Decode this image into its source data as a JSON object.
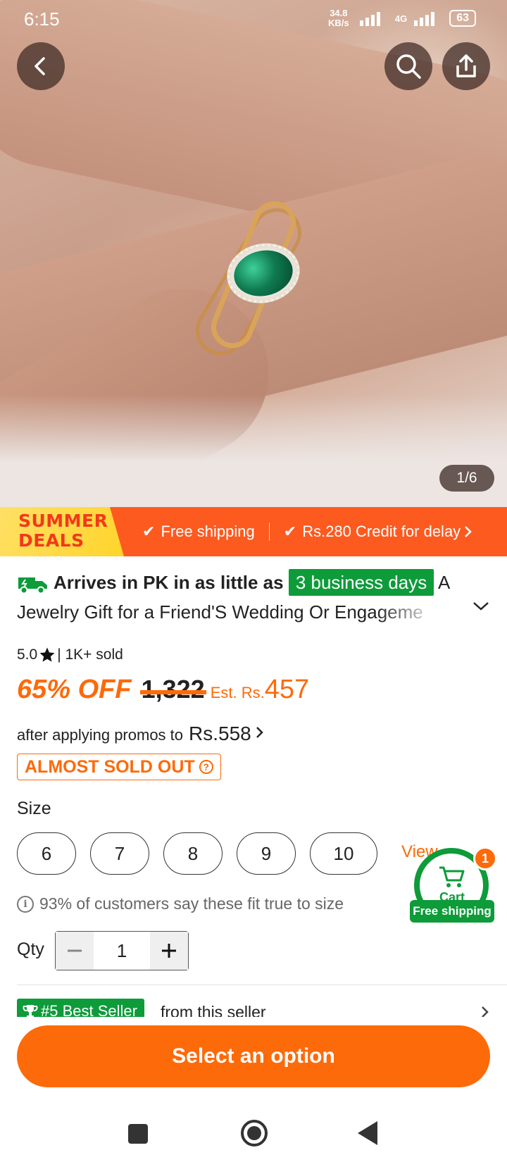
{
  "status_bar": {
    "time": "6:15",
    "network_speed": "34.8 KB/s",
    "network_type": "4G",
    "battery": "63"
  },
  "gallery": {
    "counter": "1/6"
  },
  "banner": {
    "deal_line1": "SUMMER",
    "deal_line2": "DEALS",
    "item1": "Free shipping",
    "item2": "Rs.280 Credit for delay"
  },
  "product": {
    "arrives_text": "Arrives in PK in as little as",
    "delivery_badge": "3 business days",
    "title_rest_line1": " A",
    "title_line2": "Jewelry Gift for a Friend'S Wedding Or Engageme",
    "rating": "5.0",
    "sold": "| 1K+ sold",
    "discount": "65% OFF",
    "original_price": "1,322",
    "est_label": "Est. Rs.",
    "est_value": "457",
    "promo_text": "after applying promos to",
    "promo_price": "Rs.558",
    "stock_badge": "ALMOST SOLD OUT"
  },
  "size": {
    "label": "Size",
    "options": [
      "6",
      "7",
      "8",
      "9",
      "10"
    ],
    "view_all": "View",
    "fit_note": "93% of customers say these fit true to size"
  },
  "quantity": {
    "label": "Qty",
    "value": "1"
  },
  "cart": {
    "label": "Cart",
    "count": "1",
    "free_shipping": "Free shipping"
  },
  "seller": {
    "badge": "#5 Best Seller",
    "text": "from this seller"
  },
  "cta": {
    "label": "Select an option"
  },
  "colors": {
    "accent_orange": "#fd6a0a",
    "banner_red": "#fd5a20",
    "green": "#0e9b3a"
  }
}
